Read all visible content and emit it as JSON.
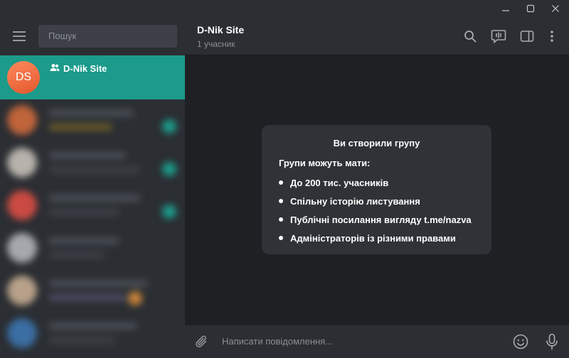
{
  "window": {
    "controls": [
      "minimize-icon",
      "maximize-icon",
      "close-icon"
    ]
  },
  "sidebar": {
    "menu_icon": "hamburger-menu-icon",
    "search_placeholder": "Пошук",
    "active_chat": {
      "avatar_initials": "DS",
      "name": "D-Nik Site",
      "type_icon": "group-icon"
    }
  },
  "chat": {
    "title": "D-Nik Site",
    "subtitle": "1 учасник",
    "header_icons": [
      "search-icon",
      "voice-chat-icon",
      "sidebar-toggle-icon",
      "more-vertical-icon"
    ]
  },
  "info_card": {
    "title": "Ви створили групу",
    "subtitle": "Групи можуть мати:",
    "items": [
      "До 200 тис. учасників",
      "Спільну історію листування",
      "Публічні посилання вигляду t.me/nazva",
      "Адміністраторів із різними правами"
    ]
  },
  "composer": {
    "placeholder": "Написати повідомлення...",
    "attach_icon": "paperclip-icon",
    "emoji_icon": "emoji-icon",
    "mic_icon": "microphone-icon"
  },
  "colors": {
    "accent": "#1c9a8a",
    "panel": "#2b2e33",
    "background": "#1e2024",
    "card": "#2f3237",
    "avatar": "#e4572e"
  }
}
